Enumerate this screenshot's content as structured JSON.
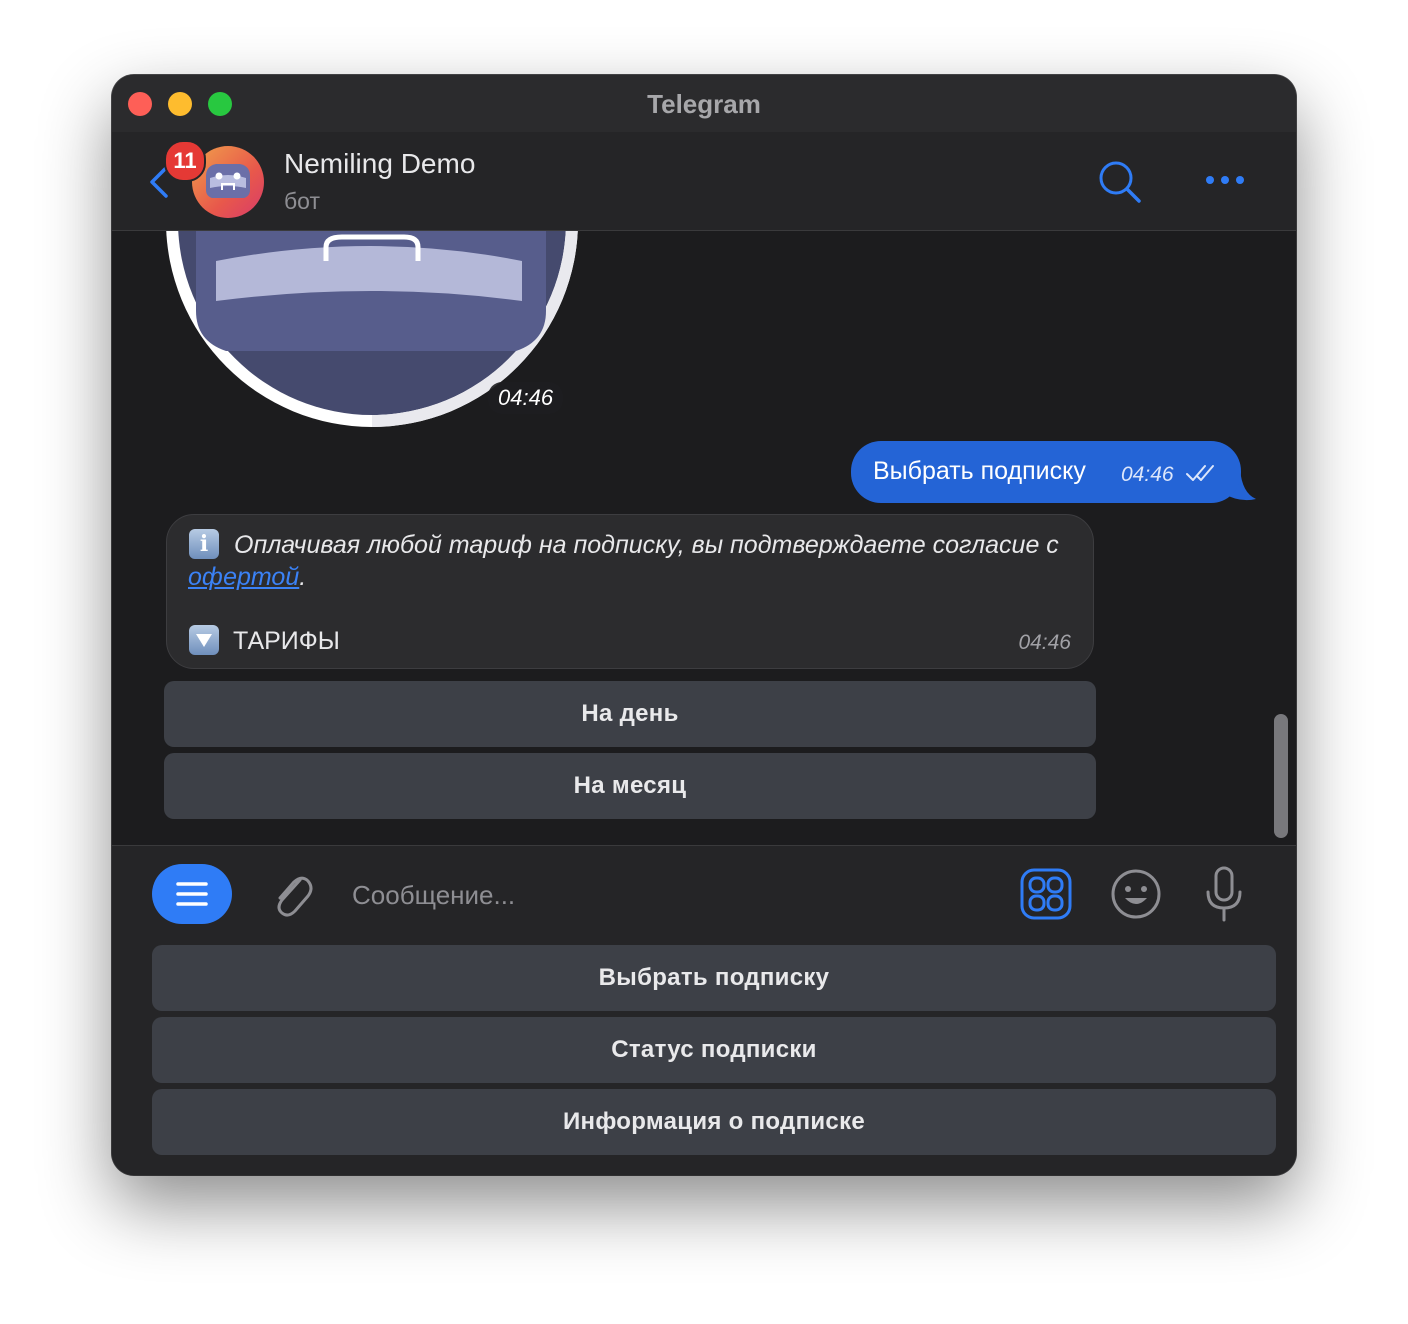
{
  "window": {
    "title": "Telegram"
  },
  "header": {
    "unread_badge": "11",
    "chat_name": "Nemiling Demo",
    "chat_status": "бот",
    "avatar_icon": "bot-avatar",
    "icons": [
      "chevron-left-icon",
      "search-icon",
      "more-icon"
    ],
    "accent": "#2f7cf6"
  },
  "messages": {
    "sticker": {
      "time": "04:46"
    },
    "outgoing": {
      "text": "Выбрать подписку",
      "time": "04:46",
      "status_icon": "double-check-icon"
    },
    "incoming": {
      "text_before_link": "Оплачивая любой тариф на подписку, вы подтверждаете согласие с ",
      "link_text": "офертой",
      "text_after_link": ".",
      "tariffs_label": "ТАРИФЫ",
      "time": "04:46"
    },
    "inline_buttons": [
      "На день",
      "На месяц"
    ]
  },
  "composer": {
    "placeholder": "Сообщение...",
    "value": "",
    "icons": [
      "menu-icon",
      "paperclip-icon",
      "keyboard-icon",
      "emoji-icon",
      "microphone-icon"
    ]
  },
  "reply_keyboard": [
    "Выбрать подписку",
    "Статус подписки",
    "Информация о подписке"
  ]
}
